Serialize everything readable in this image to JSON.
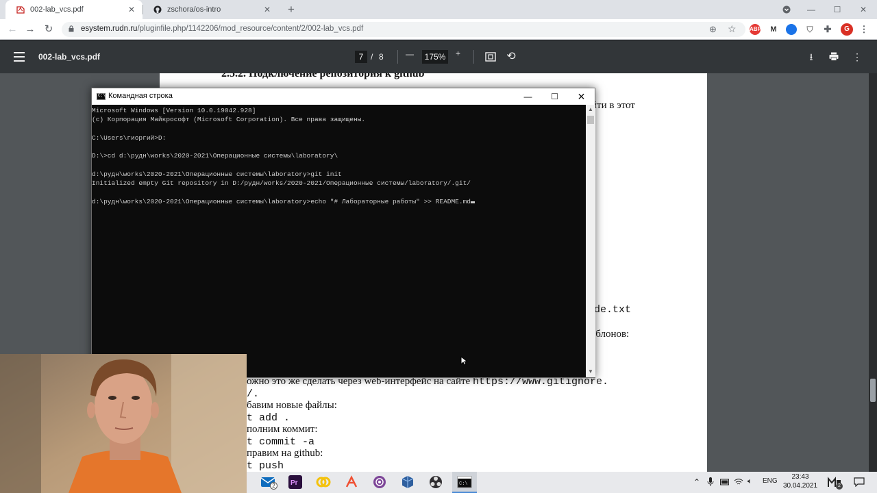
{
  "browser": {
    "tabs": [
      {
        "title": "002-lab_vcs.pdf"
      },
      {
        "title": "zschora/os-intro"
      }
    ],
    "url_host": "esystem.rudn.ru",
    "url_path": "/pluginfile.php/1142206/mod_resource/content/2/002-lab_vcs.pdf",
    "profile_initial": "G"
  },
  "pdf": {
    "filename": "002-lab_vcs.pdf",
    "page_current": "7",
    "page_separator": "/",
    "page_total": "8",
    "zoom": "175%",
    "heading": "2.5.2.   Подключение репозитория к github",
    "lines": {
      "l1": "йти в этот",
      "l2": "de.txt",
      "l3": "шаблонов:",
      "l4": "ожно это же сделать через web-интерфейс на сайте",
      "l4_url": "https://www.gitignore.",
      "l5": "/.",
      "l6": "бавим новые файлы:",
      "l7": "t add .",
      "l8": "полним коммит:",
      "l9": "t commit -a",
      "l10": "правим на github:",
      "l11": "t push"
    }
  },
  "cmd": {
    "title": "Командная строка",
    "lines": [
      "Microsoft Windows [Version 10.0.19042.928]",
      "(c) Корпорация Майкрософт (Microsoft Corporation). Все права защищены.",
      "",
      "C:\\Users\\гиоргий>D:",
      "",
      "D:\\>cd d:\\рудн\\works\\2020-2021\\Операционные системы\\laboratory\\",
      "",
      "d:\\рудн\\works\\2020-2021\\Операционные системы\\laboratory>git init",
      "Initialized empty Git repository in D:/рудн/works/2020-2021/Операционные системы/laboratory/.git/",
      "",
      "d:\\рудн\\works\\2020-2021\\Операционные системы\\laboratory>echo \"# Лабораторные работы\" >> README.md"
    ]
  },
  "taskbar": {
    "mail_badge": "2",
    "lang": "ENG",
    "time": "23:43",
    "date": "30.04.2021",
    "notif_badge": "2"
  }
}
